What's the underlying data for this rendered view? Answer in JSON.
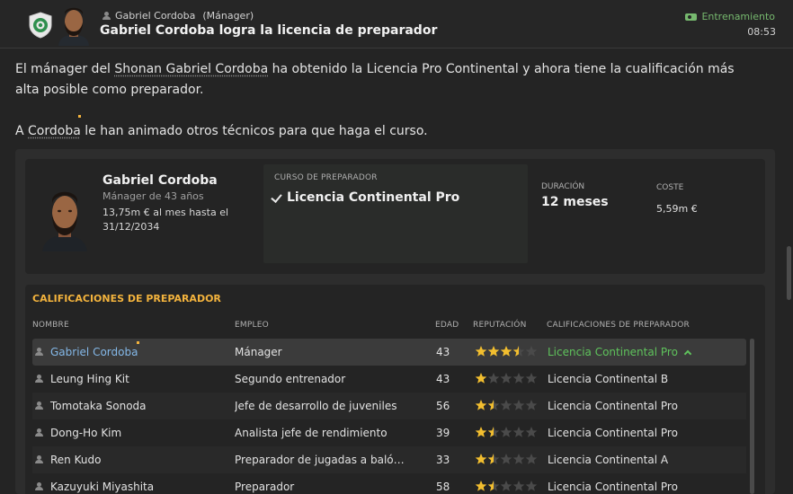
{
  "header": {
    "sender_name": "Gabriel Cordoba",
    "sender_role": "(Mánager)",
    "subject": "Gabriel Cordoba logra la licencia de preparador",
    "category": "Entrenamiento",
    "time": "08:53"
  },
  "message": {
    "p1_a": "El mánager del ",
    "p1_link": "Shonan Gabriel Cordoba",
    "p1_b": " ha obtenido la Licencia Pro Continental y ahora tiene la cualificación más alta posible como preparador.",
    "p2_a": "A ",
    "p2_link": "Cordoba",
    "p2_b": " le han animado otros técnicos para que haga el curso."
  },
  "summary": {
    "name": "Gabriel Cordoba",
    "age_text": "Mánager de 43 años",
    "contract_text": "13,75m € al mes hasta el 31/12/2034",
    "course_label": "CURSO DE PREPARADOR",
    "course_value": "Licencia Continental Pro",
    "duration_label": "DURACIÓN",
    "duration_value": "12 meses",
    "cost_label": "COSTE",
    "cost_value": "5,59m €"
  },
  "table": {
    "title": "CALIFICACIONES DE PREPARADOR",
    "columns": {
      "name": "NOMBRE",
      "job": "EMPLEO",
      "age": "EDAD",
      "rep": "REPUTACIÓN",
      "qual": "CALIFICACIONES DE PREPARADOR"
    },
    "rows": [
      {
        "name": "Gabriel Cordoba",
        "job": "Mánager",
        "age": "43",
        "stars": 3.5,
        "qual": "Licencia Continental Pro"
      },
      {
        "name": "Leung Hing Kit",
        "job": "Segundo entrenador",
        "age": "43",
        "stars": 1,
        "qual": "Licencia Continental B"
      },
      {
        "name": "Tomotaka Sonoda",
        "job": "Jefe de desarrollo de juveniles",
        "age": "56",
        "stars": 1.5,
        "qual": "Licencia Continental Pro"
      },
      {
        "name": "Dong-Ho Kim",
        "job": "Analista jefe de rendimiento",
        "age": "39",
        "stars": 1.5,
        "qual": "Licencia Continental Pro"
      },
      {
        "name": "Ren Kudo",
        "job": "Preparador de jugadas a balón…",
        "age": "33",
        "stars": 1.5,
        "qual": "Licencia Continental A"
      },
      {
        "name": "Kazuyuki Miyashita",
        "job": "Preparador",
        "age": "58",
        "stars": 1.5,
        "qual": "Licencia Continental Pro"
      }
    ]
  },
  "colors": {
    "accent_orange": "#f3b33d",
    "qual_green": "#5fc35c",
    "link_blue": "#84b8e8",
    "star_gold": "#f2be2f"
  }
}
